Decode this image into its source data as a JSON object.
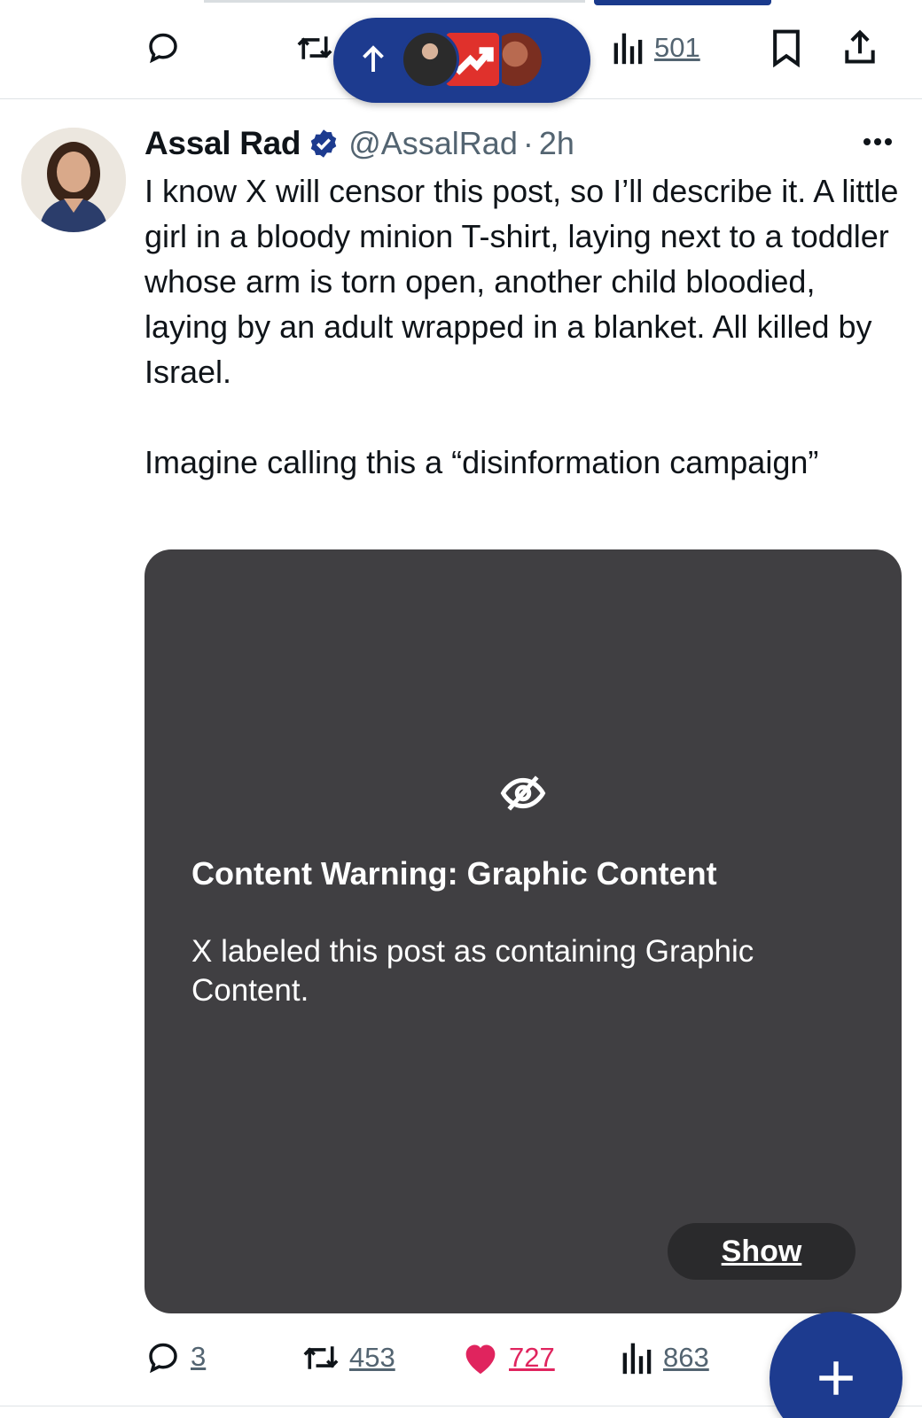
{
  "prev_post": {
    "views_count": "501"
  },
  "new_posts_pill": {
    "icon": "arrow-up-icon"
  },
  "post": {
    "author_name": "Assal Rad",
    "handle": "@AssalRad",
    "separator": "·",
    "time": "2h",
    "text": "I know X will censor this post, so I’ll describe it. A little girl in a bloody minion T-shirt, laying next to a toddler whose arm is torn open, another child bloodied, laying by an adult wrapped in a blanket. All killed by Israel.\n\nImagine calling this a “disinformation campaign”",
    "media_warning": {
      "title": "Content Warning: Graphic Content",
      "body": "X labeled this post as containing Graphic Content.",
      "show_label": "Show"
    },
    "reply_count": "3",
    "repost_count": "453",
    "like_count": "727",
    "view_count": "863"
  },
  "colors": {
    "accent_blue": "#1d3b8f",
    "like_pink": "#e0245e",
    "verified_blue": "#1d3b8f",
    "muted": "#536471"
  }
}
